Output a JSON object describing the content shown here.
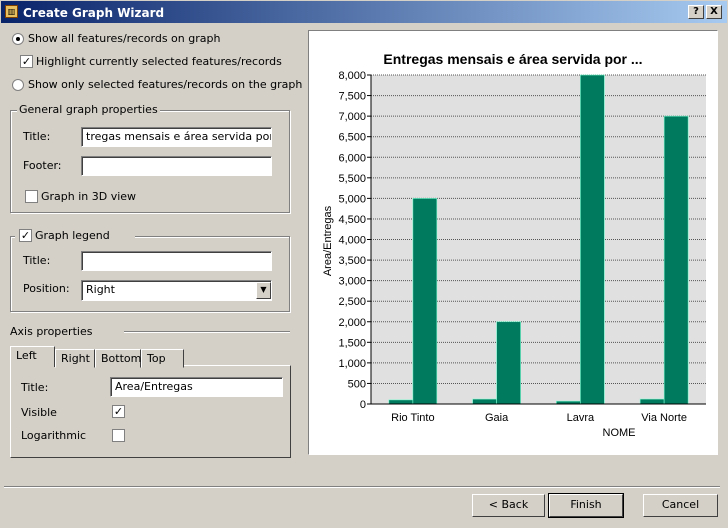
{
  "window": {
    "title": "Create Graph Wizard",
    "help": "?",
    "close": "X"
  },
  "options": {
    "show_all": {
      "label": "Show all features/records on graph",
      "selected": true
    },
    "highlight": {
      "label": "Highlight currently selected features/records",
      "checked": true
    },
    "show_selected": {
      "label": "Show only selected features/records on the graph",
      "selected": false
    }
  },
  "general": {
    "legend": "General graph properties",
    "title_label": "Title:",
    "title_value": "tregas mensais e área servida por ...",
    "footer_label": "Footer:",
    "footer_value": "",
    "three_d": {
      "label": "Graph in 3D view",
      "checked": false
    }
  },
  "graph_legend": {
    "label": "Graph legend",
    "checked": true,
    "title_label": "Title:",
    "title_value": "",
    "position_label": "Position:",
    "position_value": "Right"
  },
  "axis": {
    "legend": "Axis properties",
    "tabs": [
      "Left",
      "Right",
      "Bottom",
      "Top"
    ],
    "active_tab": "Left",
    "title_label": "Title:",
    "title_value": "Area/Entregas",
    "visible_label": "Visible",
    "visible": true,
    "log_label": "Logarithmic",
    "logarithmic": false
  },
  "buttons": {
    "back": "< Back",
    "finish": "Finish",
    "cancel": "Cancel"
  },
  "chart_data": {
    "type": "bar",
    "title": "Entregas mensais e área servida por ...",
    "xlabel": "NOME",
    "ylabel": "Area/Entregas",
    "categories": [
      "Rio Tinto",
      "Gaia",
      "Lavra",
      "Via Norte"
    ],
    "series": [
      {
        "values": [
          100,
          120,
          70,
          120
        ]
      },
      {
        "values": [
          5000,
          2000,
          8000,
          7000
        ]
      }
    ],
    "ylim": [
      0,
      8000
    ],
    "yticks": [
      "0",
      "500",
      "1,000",
      "1,500",
      "2,000",
      "2,500",
      "3,000",
      "3,500",
      "4,000",
      "4,500",
      "5,000",
      "5,500",
      "6,000",
      "6,500",
      "7,000",
      "7,500",
      "8,000"
    ],
    "grid": true,
    "colors": {
      "bar": "#007a5e",
      "plot_bg": "#e0e0e0",
      "bar_edge": "#7fffd4"
    }
  }
}
